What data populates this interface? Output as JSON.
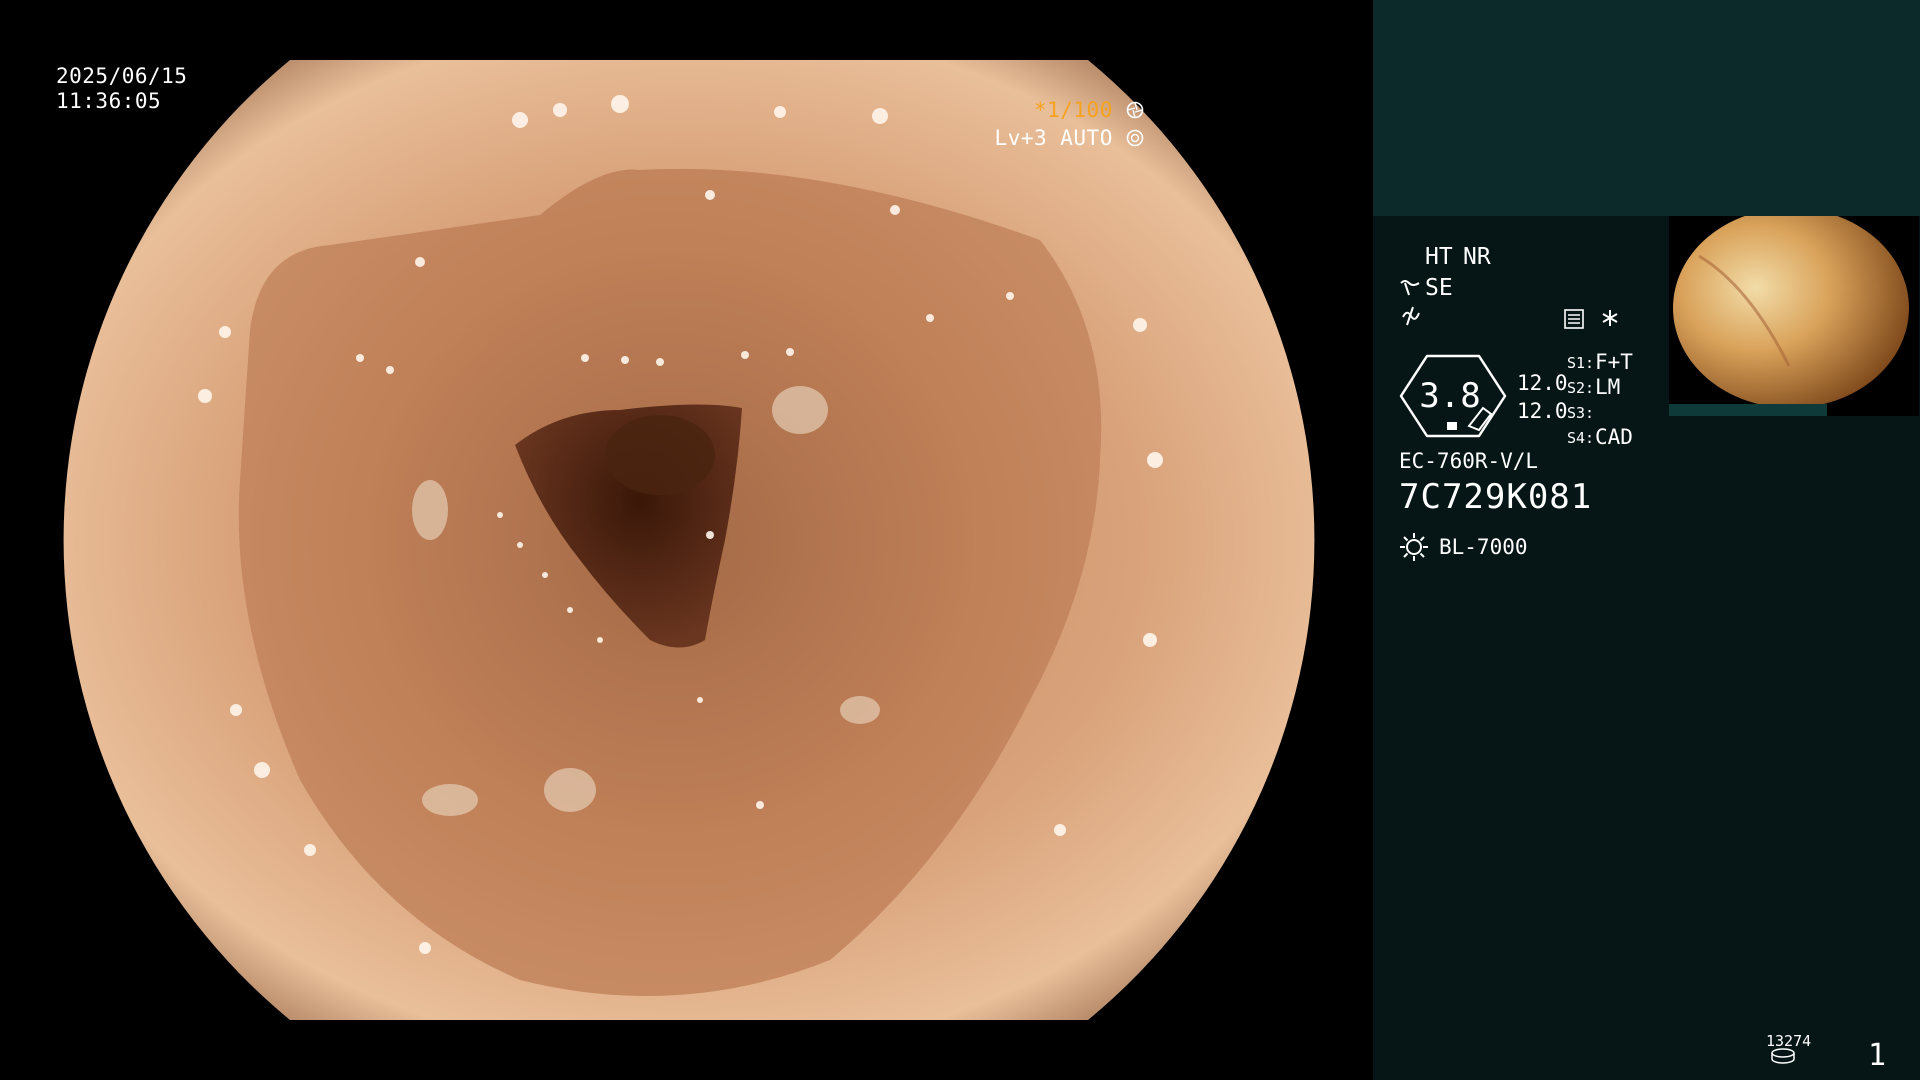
{
  "overlay": {
    "date": "2025/06/15",
    "time": "11:36:05",
    "shutter": "*1/100",
    "level": "Lv+3 AUTO"
  },
  "panel": {
    "ht": "HT",
    "nr": "NR",
    "se": "SE",
    "gauge_value": "3.8",
    "num_a": "12.0",
    "num_b": "12.0",
    "switches": [
      {
        "key": "S1:",
        "value": "F+T"
      },
      {
        "key": "S2:",
        "value": "LM"
      },
      {
        "key": "S3:",
        "value": ""
      },
      {
        "key": "S4:",
        "value": "CAD"
      }
    ],
    "model": "EC-760R-V/L",
    "serial": "7C729K081",
    "light_source": "BL-7000"
  },
  "status": {
    "counter": "13274",
    "page": "1"
  },
  "colors": {
    "accent_orange": "#f6a21e",
    "panel_bg": "#061515",
    "panel_top": "#0d2a2a"
  }
}
